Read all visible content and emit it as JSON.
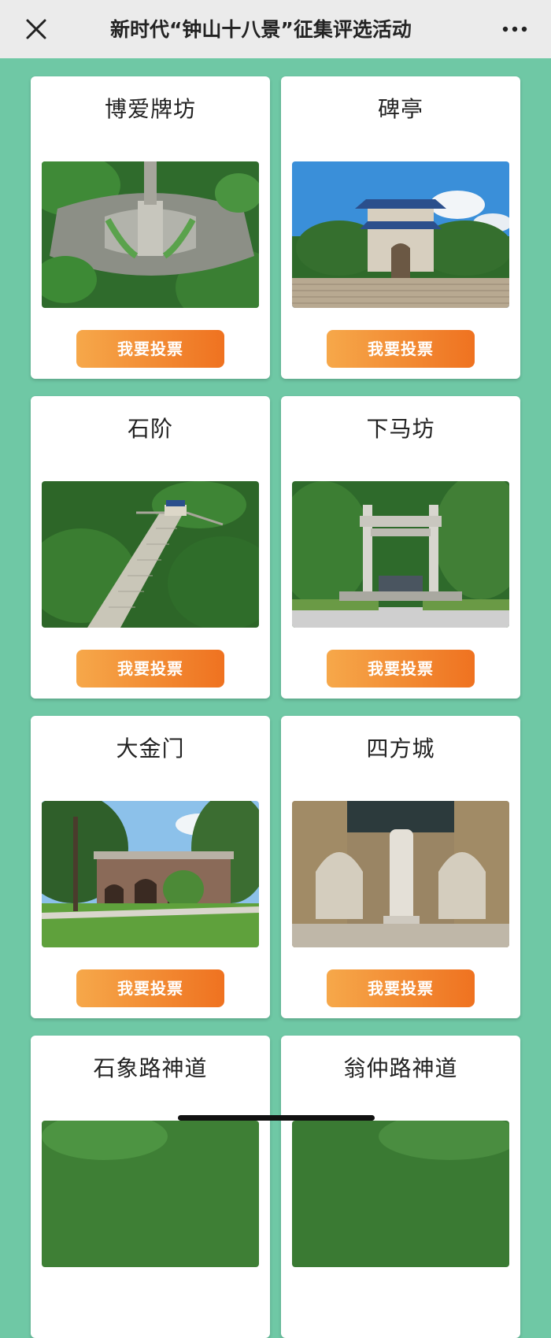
{
  "header": {
    "title": "新时代“钟山十八景”征集评选活动",
    "close_icon": "close-icon",
    "more_icon": "more-dots-icon"
  },
  "vote_label": "我要投票",
  "colors": {
    "background": "#6fc8a5",
    "button_start": "#f6a84a",
    "button_end": "#ef7220",
    "topbar": "#ebebeb"
  },
  "cards": [
    {
      "title": "博爱牌坊"
    },
    {
      "title": "碑亭"
    },
    {
      "title": "石阶"
    },
    {
      "title": "下马坊"
    },
    {
      "title": "大金门"
    },
    {
      "title": "四方城"
    },
    {
      "title": "石象路神道"
    },
    {
      "title": "翁仲路神道"
    }
  ]
}
